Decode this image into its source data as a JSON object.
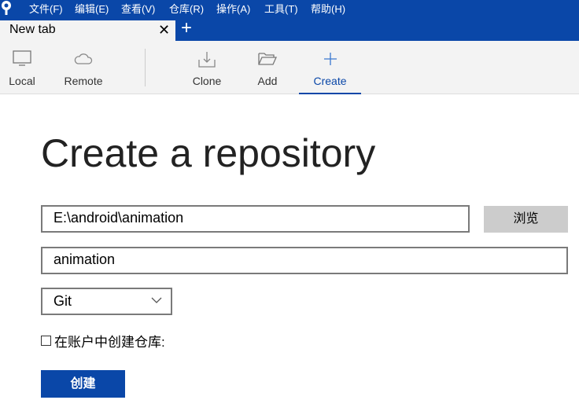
{
  "menubar": {
    "items": [
      "文件(F)",
      "编辑(E)",
      "查看(V)",
      "仓库(R)",
      "操作(A)",
      "工具(T)",
      "帮助(H)"
    ]
  },
  "tabs": {
    "active": "New tab"
  },
  "toolbar": {
    "local": "Local",
    "remote": "Remote",
    "clone": "Clone",
    "add": "Add",
    "create": "Create"
  },
  "main": {
    "title": "Create a repository",
    "path_value": "E:\\android\\animation",
    "browse": "浏览",
    "name_value": "animation",
    "vcs_selected": "Git",
    "account_checkbox": "在账户中创建仓库:",
    "create_button": "创建"
  },
  "colors": {
    "accent": "#0a47a8"
  }
}
